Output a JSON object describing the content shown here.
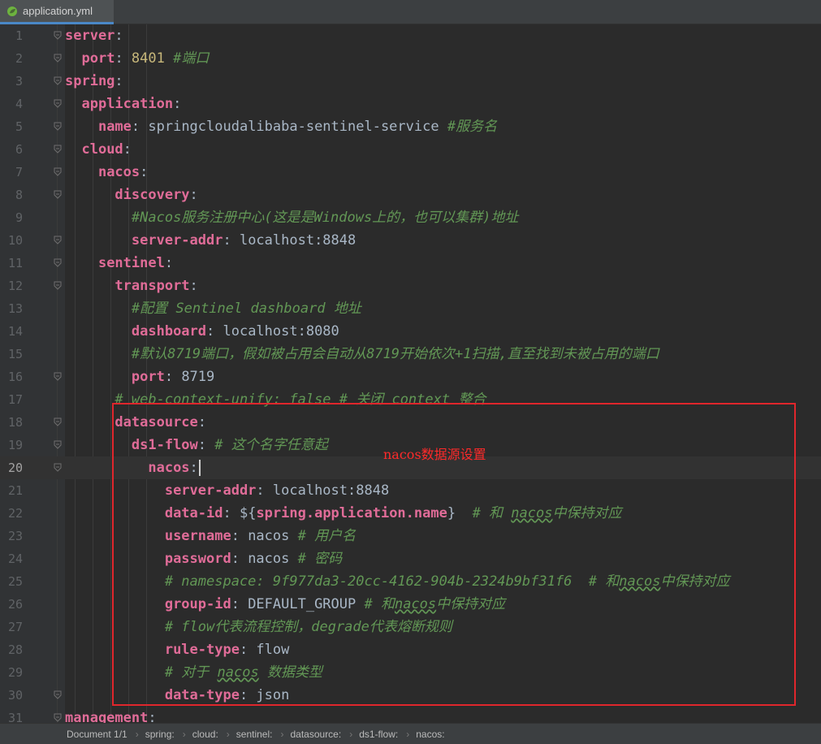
{
  "tab": {
    "label": "application.yml",
    "icon": "spring-leaf-icon"
  },
  "lines": [
    {
      "n": "1",
      "segs": [
        {
          "t": "server",
          "c": "k"
        },
        {
          "t": ":"
        }
      ]
    },
    {
      "n": "2",
      "segs": [
        {
          "t": "  "
        },
        {
          "t": "port",
          "c": "k"
        },
        {
          "t": ": "
        },
        {
          "t": "8401",
          "c": "num"
        },
        {
          "t": " "
        },
        {
          "t": "#端口",
          "c": "cm"
        }
      ]
    },
    {
      "n": "3",
      "segs": [
        {
          "t": "spring",
          "c": "k"
        },
        {
          "t": ":"
        }
      ]
    },
    {
      "n": "4",
      "segs": [
        {
          "t": "  "
        },
        {
          "t": "application",
          "c": "k"
        },
        {
          "t": ":"
        }
      ]
    },
    {
      "n": "5",
      "segs": [
        {
          "t": "    "
        },
        {
          "t": "name",
          "c": "k"
        },
        {
          "t": ": springcloudalibaba-sentinel-service "
        },
        {
          "t": "#服务名",
          "c": "cm"
        }
      ]
    },
    {
      "n": "6",
      "segs": [
        {
          "t": "  "
        },
        {
          "t": "cloud",
          "c": "k"
        },
        {
          "t": ":"
        }
      ]
    },
    {
      "n": "7",
      "segs": [
        {
          "t": "    "
        },
        {
          "t": "nacos",
          "c": "k"
        },
        {
          "t": ":"
        }
      ]
    },
    {
      "n": "8",
      "segs": [
        {
          "t": "      "
        },
        {
          "t": "discovery",
          "c": "k"
        },
        {
          "t": ":"
        }
      ]
    },
    {
      "n": "9",
      "segs": [
        {
          "t": "        "
        },
        {
          "t": "#Nacos服务注册中心(这是是Windows上的，也可以集群)地址",
          "c": "cm"
        }
      ]
    },
    {
      "n": "10",
      "segs": [
        {
          "t": "        "
        },
        {
          "t": "server-addr",
          "c": "k"
        },
        {
          "t": ": localhost:8848"
        }
      ]
    },
    {
      "n": "11",
      "segs": [
        {
          "t": "    "
        },
        {
          "t": "sentinel",
          "c": "k"
        },
        {
          "t": ":"
        }
      ]
    },
    {
      "n": "12",
      "segs": [
        {
          "t": "      "
        },
        {
          "t": "transport",
          "c": "k"
        },
        {
          "t": ":"
        }
      ]
    },
    {
      "n": "13",
      "segs": [
        {
          "t": "        "
        },
        {
          "t": "#配置 Sentinel dashboard 地址",
          "c": "cm"
        }
      ]
    },
    {
      "n": "14",
      "segs": [
        {
          "t": "        "
        },
        {
          "t": "dashboard",
          "c": "k"
        },
        {
          "t": ": localhost:8080"
        }
      ]
    },
    {
      "n": "15",
      "segs": [
        {
          "t": "        "
        },
        {
          "t": "#默认8719端口，假如被占用会自动从8719开始依次+1扫描,直至找到未被占用的端口",
          "c": "cm"
        }
      ]
    },
    {
      "n": "16",
      "segs": [
        {
          "t": "        "
        },
        {
          "t": "port",
          "c": "k"
        },
        {
          "t": ": 8719"
        }
      ]
    },
    {
      "n": "17",
      "segs": [
        {
          "t": "      "
        },
        {
          "t": "# web-context-unify: false # 关闭 context 整合",
          "c": "cm"
        }
      ]
    },
    {
      "n": "18",
      "segs": [
        {
          "t": "      "
        },
        {
          "t": "datasource",
          "c": "k"
        },
        {
          "t": ":"
        }
      ]
    },
    {
      "n": "19",
      "segs": [
        {
          "t": "        "
        },
        {
          "t": "ds1-flow",
          "c": "k"
        },
        {
          "t": ": "
        },
        {
          "t": "# 这个名字任意起",
          "c": "cm"
        }
      ]
    },
    {
      "n": "20",
      "current": true,
      "segs": [
        {
          "t": "          "
        },
        {
          "t": "nacos",
          "c": "k"
        },
        {
          "t": ":"
        }
      ]
    },
    {
      "n": "21",
      "segs": [
        {
          "t": "            "
        },
        {
          "t": "server-addr",
          "c": "k"
        },
        {
          "t": ": localhost:8848"
        }
      ]
    },
    {
      "n": "22",
      "segs": [
        {
          "t": "            "
        },
        {
          "t": "data-id",
          "c": "k"
        },
        {
          "t": ": ${"
        },
        {
          "t": "spring.application.name",
          "c": "k"
        },
        {
          "t": "}  "
        },
        {
          "t": "# 和 ",
          "c": "cm"
        },
        {
          "t": "nacos",
          "c": "cm sq"
        },
        {
          "t": "中保持对应",
          "c": "cm"
        }
      ]
    },
    {
      "n": "23",
      "segs": [
        {
          "t": "            "
        },
        {
          "t": "username",
          "c": "k"
        },
        {
          "t": ": nacos "
        },
        {
          "t": "# 用户名",
          "c": "cm"
        }
      ]
    },
    {
      "n": "24",
      "segs": [
        {
          "t": "            "
        },
        {
          "t": "password",
          "c": "k"
        },
        {
          "t": ": nacos "
        },
        {
          "t": "# 密码",
          "c": "cm"
        }
      ]
    },
    {
      "n": "25",
      "segs": [
        {
          "t": "            "
        },
        {
          "t": "# namespace: 9f977da3-20cc-4162-904b-2324b9bf31f6  # 和",
          "c": "cm"
        },
        {
          "t": "nacos",
          "c": "cm sq"
        },
        {
          "t": "中保持对应",
          "c": "cm"
        }
      ]
    },
    {
      "n": "26",
      "segs": [
        {
          "t": "            "
        },
        {
          "t": "group-id",
          "c": "k"
        },
        {
          "t": ": DEFAULT_GROUP "
        },
        {
          "t": "# 和",
          "c": "cm"
        },
        {
          "t": "nacos",
          "c": "cm sq"
        },
        {
          "t": "中保持对应",
          "c": "cm"
        }
      ]
    },
    {
      "n": "27",
      "segs": [
        {
          "t": "            "
        },
        {
          "t": "# flow代表流程控制，degrade代表熔断规则",
          "c": "cm"
        }
      ]
    },
    {
      "n": "28",
      "segs": [
        {
          "t": "            "
        },
        {
          "t": "rule-type",
          "c": "k"
        },
        {
          "t": ": flow"
        }
      ]
    },
    {
      "n": "29",
      "segs": [
        {
          "t": "            "
        },
        {
          "t": "# 对于 ",
          "c": "cm"
        },
        {
          "t": "nacos",
          "c": "cm sq"
        },
        {
          "t": " 数据类型",
          "c": "cm"
        }
      ]
    },
    {
      "n": "30",
      "segs": [
        {
          "t": "            "
        },
        {
          "t": "data-type",
          "c": "k"
        },
        {
          "t": ": json"
        }
      ]
    },
    {
      "n": "31",
      "segs": [
        {
          "t": "management",
          "c": "k"
        },
        {
          "t": ":"
        }
      ]
    }
  ],
  "annotation": "nacos数据源设置",
  "statusbar": {
    "document": "Document 1/1",
    "breadcrumbs": [
      "spring:",
      "cloud:",
      "sentinel:",
      "datasource:",
      "ds1-flow:",
      "nacos:"
    ]
  },
  "colors": {
    "key": "#e06c98",
    "comment": "#629755",
    "number": "#c7b77a",
    "highlight_box": "#e0262c"
  }
}
